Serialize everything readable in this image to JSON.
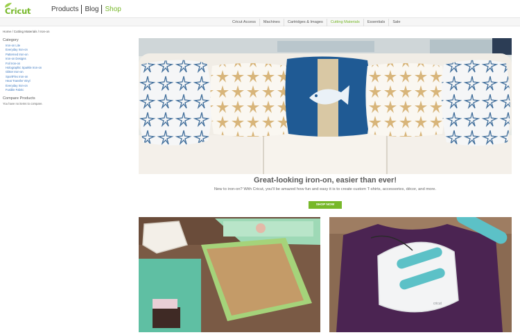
{
  "header": {
    "logo_text": "Cricut",
    "nav": [
      {
        "label": "Products"
      },
      {
        "label": "Blog"
      },
      {
        "label": "Shop"
      }
    ]
  },
  "subnav": {
    "items": [
      "Cricut Access",
      "Machines",
      "Cartridges & Images",
      "Cutting Materials",
      "Essentials",
      "Sale"
    ]
  },
  "breadcrumb": "Home / Cutting Materials / Iron-on",
  "sidebar": {
    "category_heading": "Category",
    "categories": [
      "Iron-on Lite",
      "Everyday Iron-on",
      "Patterned Iron-on",
      "Iron-on Designs",
      "Foil Iron-on",
      "Holographic Sparkle Iron-on",
      "Glitter Iron-on",
      "SportFlex Iron-on",
      "Heat Transfer Vinyl",
      "Everyday Iron-on",
      "Fusible Fabric"
    ],
    "compare_heading": "Compare Products",
    "compare_note": "You have no items to compare."
  },
  "promo": {
    "title": "Great-looking iron-on, easier than ever!",
    "subtitle": "New to iron-on? With Cricut, you'll be amazed how fun and easy it is to create custom T-shirts, accessories, décor, and more.",
    "button_label": "SHOP NOW"
  },
  "images": {
    "right_press_brand": "cricut"
  },
  "colors": {
    "brand_green": "#77b82a",
    "link_blue": "#3b78c0",
    "teal": "#5cc1c7",
    "purple_shirt": "#4b2452"
  }
}
